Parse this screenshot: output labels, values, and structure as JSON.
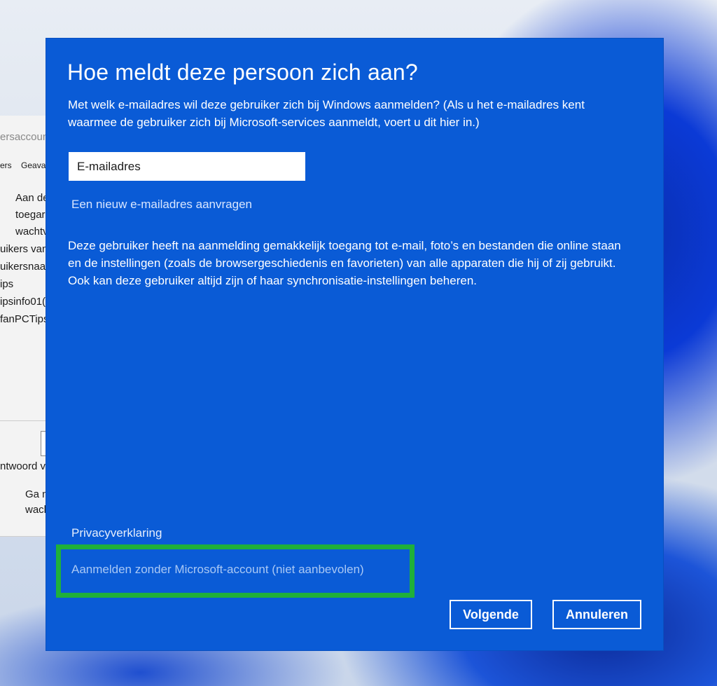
{
  "background_window": {
    "title_fragment": "ersaccount",
    "tabs": [
      "ers",
      "Geava"
    ],
    "lines": [
      "Aan de",
      "toegar",
      "wachtv"
    ],
    "section_label": "uikers van",
    "list": [
      "uikersnaa",
      "ips",
      "ipsinfo01(",
      "fanPCTips"
    ],
    "bottom_label": "ntwoord v",
    "bottom_lines": [
      "Ga n",
      "wach"
    ]
  },
  "dialog": {
    "title": "Hoe meldt deze persoon zich aan?",
    "subtitle": "Met welk e-mailadres wil deze gebruiker zich bij Windows aanmelden? (Als u het e-mailadres kent waarmee de gebruiker zich bij Microsoft-services aanmeldt, voert u dit hier in.)",
    "email_input": {
      "placeholder": "E-mailadres",
      "value": ""
    },
    "new_email_link": "Een nieuw e-mailadres aanvragen",
    "description": "Deze gebruiker heeft na aanmelding gemakkelijk toegang tot e-mail, foto’s en bestanden die online staan en de instellingen (zoals de browsergeschiedenis en favorieten) van alle apparaten die hij of zij gebruikt. Ook kan deze gebruiker altijd zijn of haar synchronisatie-instellingen beheren.",
    "privacy_link": "Privacyverklaring",
    "no_microsoft_account_link": "Aanmelden zonder Microsoft-account (niet aanbevolen)",
    "buttons": {
      "next": "Volgende",
      "cancel": "Annuleren"
    }
  },
  "colors": {
    "dialog_background": "#0a5bd6",
    "highlight": "#1fb03a",
    "link": "#a9c8f5"
  }
}
